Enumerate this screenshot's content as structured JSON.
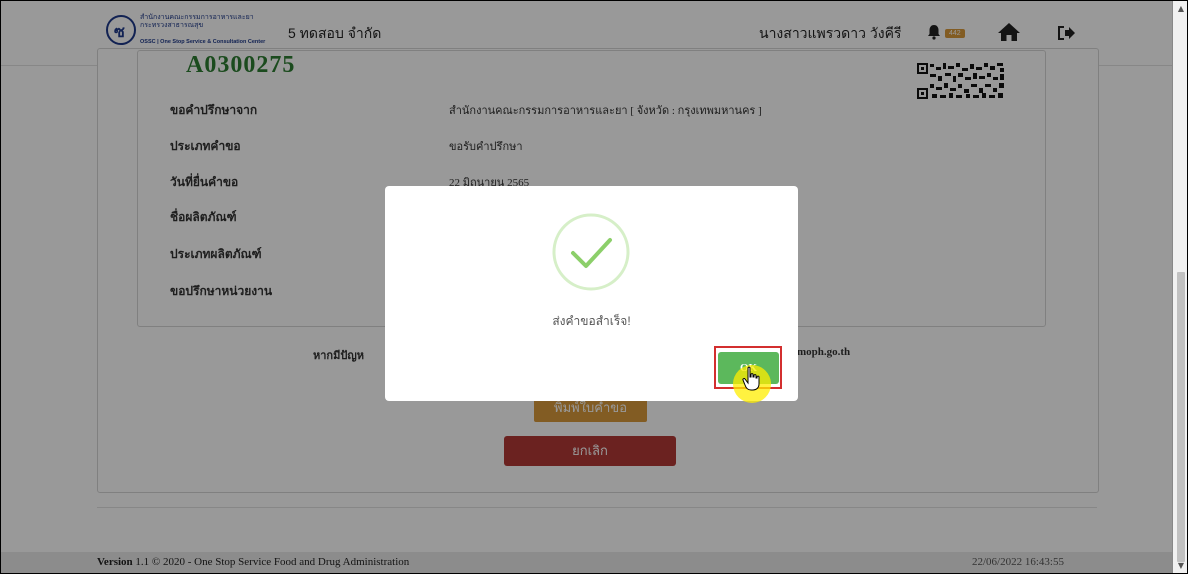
{
  "header": {
    "logo_line1": "สำนักงานคณะกรรมการอาหารและยา",
    "logo_line2": "กระทรวงสาธารณสุข",
    "logo_ossc": "OSSC | One Stop Service & Consultation Center",
    "company_name": "5 ทดสอบ จำกัด",
    "user_name": "นางสาวแพรวดาว วังคีรี",
    "notification_count": "442",
    "icons": [
      "bell-icon",
      "home-icon",
      "logout-icon"
    ]
  },
  "request": {
    "number": "A0300275",
    "rows": [
      {
        "label": "ขอคำปรึกษาจาก",
        "value": "สำนักงานคณะกรรมการอาหารและยา [ จังหวัด : กรุงเทพมหานคร ]"
      },
      {
        "label": "ประเภทคำขอ",
        "value": "ขอรับคำปรึกษา"
      },
      {
        "label": "วันที่ยื่นคำขอ",
        "value": "22 มิถุนายน 2565"
      },
      {
        "label": "ชื่อผลิตภัณฑ์",
        "value": ""
      },
      {
        "label": "ประเภทผลิตภัณฑ์",
        "value": ""
      },
      {
        "label": "ขอปรึกษาหน่วยงาน",
        "value": ""
      }
    ]
  },
  "help": {
    "text": "หากมีปัญห",
    "email": "moph.go.th"
  },
  "buttons": {
    "print": "พิมพ์ใบคำขอ",
    "cancel": "ยกเลิก"
  },
  "modal": {
    "message": "ส่งคำขอสำเร็จ!",
    "ok_label": "OK"
  },
  "footer": {
    "version_label": "Version",
    "version_text": " 1.1 © 2020 - One Stop Service Food and Drug Administration",
    "datetime": "22/06/2022 16:43:55"
  },
  "colors": {
    "success_green": "#5cb85c",
    "cancel_red": "#b23a36",
    "print_orange": "#d99a3b",
    "highlight_red": "#d32f2f"
  }
}
